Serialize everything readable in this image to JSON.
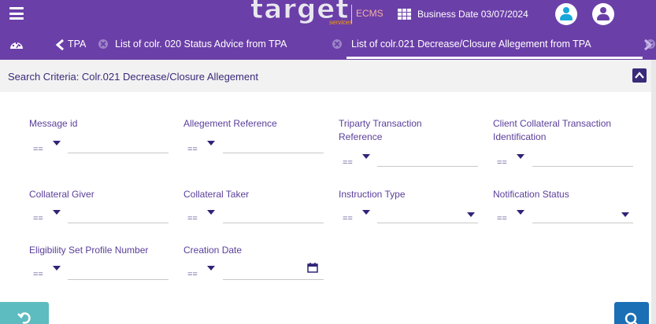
{
  "header": {
    "logo_text": "target",
    "logo_sub": "services",
    "logo_app": "ECMS",
    "business_date_label": "Business Date 03/07/2024"
  },
  "tabs": [
    {
      "label": "TPA",
      "active": false
    },
    {
      "label": "List of colr. 020 Status Advice from TPA",
      "active": false
    },
    {
      "label": "List of colr.021 Decrease/Closure Allegement from TPA",
      "active": true
    }
  ],
  "panel": {
    "title": "Search Criteria: Colr.021 Decrease/Closure Allegement"
  },
  "operator_default": "==",
  "fields": [
    {
      "label": "Message id",
      "operator": "==",
      "value": ""
    },
    {
      "label": "Allegement Reference",
      "operator": "==",
      "value": ""
    },
    {
      "label": "Triparty Transaction Reference",
      "operator": "==",
      "value": ""
    },
    {
      "label": "Client Collateral Transaction Identification",
      "operator": "==",
      "value": ""
    },
    {
      "label": "Collateral Giver",
      "operator": "==",
      "value": ""
    },
    {
      "label": "Collateral Taker",
      "operator": "==",
      "value": ""
    },
    {
      "label": "Instruction Type",
      "operator": "==",
      "value": ""
    },
    {
      "label": "Notification Status",
      "operator": "==",
      "value": ""
    },
    {
      "label": "Eligibility Set Profile Number",
      "operator": "==",
      "value": ""
    },
    {
      "label": "Creation Date",
      "operator": "==",
      "value": ""
    }
  ],
  "colors": {
    "brand": "#6b3fa8",
    "title": "#3a2a7a",
    "reset_button": "#5cbcc0",
    "search_button": "#1a6fb5"
  },
  "icons": {
    "menu": "hamburger-icon",
    "dashboard": "gauge-icon",
    "apps": "grid-icon",
    "user": "user-icon",
    "calendar": "calendar-icon",
    "reset": "undo-icon",
    "search": "search-icon"
  }
}
